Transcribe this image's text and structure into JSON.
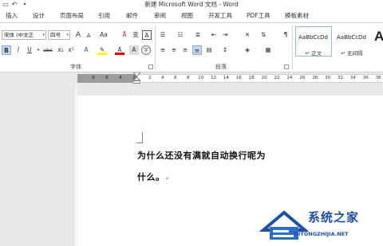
{
  "window": {
    "title": "新建 Microsoft Word 文档 - Word"
  },
  "quick_access": {
    "icons": [
      "save-icon",
      "undo-icon"
    ]
  },
  "tabs": [
    {
      "label": "插入"
    },
    {
      "label": "设计"
    },
    {
      "label": "页面布局"
    },
    {
      "label": "引用"
    },
    {
      "label": "邮件"
    },
    {
      "label": "审阅"
    },
    {
      "label": "视图"
    },
    {
      "label": "开发工具"
    },
    {
      "label": "PDF工具"
    },
    {
      "label": "模板素材"
    }
  ],
  "font": {
    "family_value": "宋体 (中文正",
    "size_value": "四号",
    "grow_label": "A",
    "shrink_label": "A",
    "case_label": "Aa",
    "bold_label": "B",
    "italic_label": "I",
    "underline_label": "U",
    "strike_label": "abc",
    "subscript_label": "x₂",
    "superscript_label": "x²",
    "clear_label": "A",
    "group_label": "字体"
  },
  "paragraph": {
    "group_label": "段落"
  },
  "styles": {
    "items": [
      {
        "sample": "AaBbCcDd",
        "name": "↵ 正文"
      },
      {
        "sample": "AaBbCcDd",
        "name": "↵ 无间隔"
      },
      {
        "sample": "A",
        "name": ""
      }
    ]
  },
  "ruler": {
    "left_numbers": [
      "8",
      "6",
      "4",
      "2"
    ],
    "numbers": [
      "2",
      "4",
      "6",
      "8",
      "10",
      "12",
      "14",
      "16",
      "18",
      "20",
      "22",
      "24",
      "26",
      "28",
      "30",
      "32",
      "34",
      "36",
      "38"
    ]
  },
  "document": {
    "line1": "为什么还没有满就自动换行呢为",
    "line2": "什么。",
    "para_mark": "↵"
  },
  "watermark": {
    "text": "系统之家",
    "url": "XITONGZHIJIA.NET"
  },
  "colors": {
    "accent": "#2b579a",
    "highlight": "#ffff00",
    "font_color": "#e00000"
  }
}
